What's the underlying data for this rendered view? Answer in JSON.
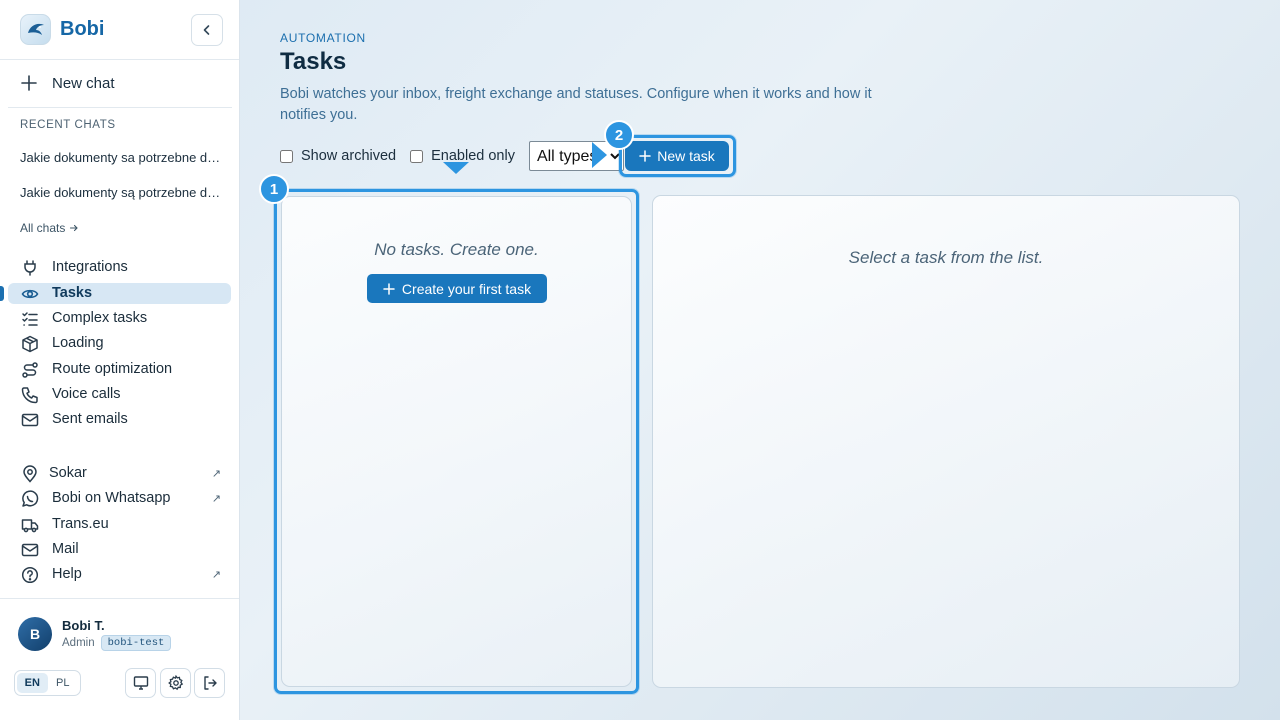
{
  "brand": {
    "name": "Bobi"
  },
  "sidebar": {
    "new_chat": "New chat",
    "recent_title": "RECENT CHATS",
    "recent_chats": [
      "Jakie dokumenty sa potrzebne do...",
      "Jakie dokumenty są potrzebne do..."
    ],
    "all_chats": "All chats",
    "nav": [
      {
        "label": "Integrations",
        "icon": "plug-icon"
      },
      {
        "label": "Tasks",
        "icon": "eye-icon",
        "active": true
      },
      {
        "label": "Complex tasks",
        "icon": "checklist-icon"
      },
      {
        "label": "Loading",
        "icon": "package-icon"
      },
      {
        "label": "Route optimization",
        "icon": "route-icon"
      },
      {
        "label": "Voice calls",
        "icon": "phone-icon"
      },
      {
        "label": "Sent emails",
        "icon": "mail-icon"
      }
    ],
    "links": [
      {
        "label": "Sokar",
        "icon": "map-pin-icon",
        "external": true
      },
      {
        "label": "Bobi on Whatsapp",
        "icon": "whatsapp-icon",
        "external": true
      },
      {
        "label": "Trans.eu",
        "icon": "truck-icon",
        "external": false
      },
      {
        "label": "Mail",
        "icon": "mail-icon",
        "external": false
      },
      {
        "label": "Help",
        "icon": "help-icon",
        "external": true
      }
    ],
    "user": {
      "initial": "B",
      "name": "Bobi T.",
      "role": "Admin",
      "org": "bobi-test"
    },
    "languages": [
      "EN",
      "PL"
    ],
    "active_language": "EN"
  },
  "main": {
    "eyebrow": "AUTOMATION",
    "title": "Tasks",
    "subtitle": "Bobi watches your inbox, freight exchange and statuses. Configure when it works and how it notifies you.",
    "filters": {
      "show_archived": "Show archived",
      "enabled_only": "Enabled only",
      "type_selected": "All types"
    },
    "new_task": "New task",
    "list_empty": "No tasks. Create one.",
    "create_first": "Create your first task",
    "detail_empty": "Select a task from the list."
  },
  "annotations": {
    "marker_1": "1",
    "marker_2": "2"
  },
  "colors": {
    "accent": "#1a77bd",
    "highlight": "#2d95e0"
  }
}
